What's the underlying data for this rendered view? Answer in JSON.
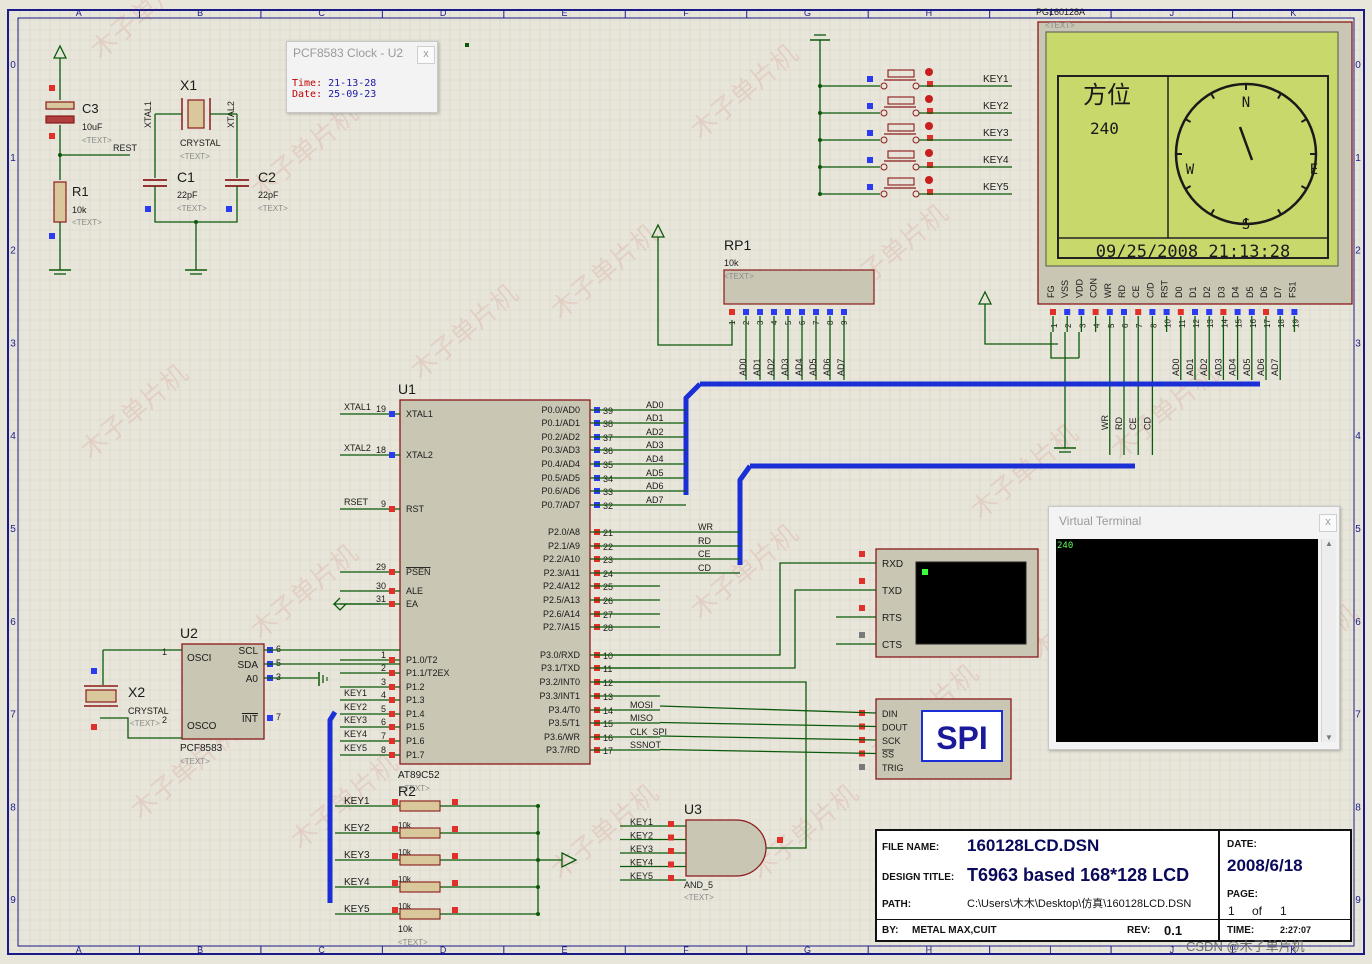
{
  "grid": {
    "cols": [
      "A",
      "B",
      "C",
      "D",
      "E",
      "F",
      "G",
      "H",
      "I",
      "J",
      "K"
    ],
    "rows": [
      "0",
      "1",
      "2",
      "3",
      "4",
      "5",
      "6",
      "7",
      "8",
      "9"
    ]
  },
  "clock_window": {
    "title": "PCF8583 Clock - U2",
    "close": "x",
    "time_label": "Time:",
    "time_value": "21-13-28",
    "date_label": "Date:",
    "date_value": "25-09-23"
  },
  "lcd": {
    "part": "PG160128A",
    "text_tag": "<TEXT>",
    "heading": "方位",
    "value": "240",
    "compass": {
      "north": "N",
      "south": "S",
      "east": "E",
      "west": "W"
    },
    "datetime": "09/25/2008 21:13:28",
    "pins": [
      "FG",
      "VSS",
      "VDD",
      "CON",
      "WR",
      "RD",
      "CE",
      "C/D",
      "RST",
      "D0",
      "D1",
      "D2",
      "D3",
      "D4",
      "D5",
      "D6",
      "D7",
      "FS1"
    ],
    "pin_numbers": [
      "1",
      "2",
      "3",
      "4",
      "5",
      "6",
      "7",
      "8",
      "10",
      "11",
      "12",
      "13",
      "14",
      "15",
      "16",
      "17",
      "18",
      "19"
    ],
    "bus_labels": [
      "AD0",
      "AD1",
      "AD2",
      "AD3",
      "AD4",
      "AD5",
      "AD6",
      "AD7"
    ],
    "ctrl_labels": [
      "WR",
      "RD",
      "CE",
      "CD"
    ]
  },
  "virtual_terminal": {
    "title": "Virtual Terminal",
    "close": "x",
    "output": "240"
  },
  "keys": [
    "KEY1",
    "KEY2",
    "KEY3",
    "KEY4",
    "KEY5"
  ],
  "components": {
    "c3": {
      "name": "C3",
      "value": "10uF",
      "text": "<TEXT>"
    },
    "rest_net": "REST",
    "r1": {
      "name": "R1",
      "value": "10k",
      "text": "<TEXT>"
    },
    "x1": {
      "name": "X1",
      "value": "CRYSTAL",
      "text": "<TEXT>",
      "left_net": "XTAL1",
      "right_net": "XTAL2"
    },
    "c1": {
      "name": "C1",
      "value": "22pF",
      "text": "<TEXT>"
    },
    "c2": {
      "name": "C2",
      "value": "22pF",
      "text": "<TEXT>"
    },
    "rp1": {
      "name": "RP1",
      "value": "10k",
      "text": "<TEXT>",
      "pins": [
        "1",
        "2",
        "3",
        "4",
        "5",
        "6",
        "7",
        "8",
        "9"
      ]
    },
    "u1": {
      "name": "U1",
      "part": "AT89C52",
      "text": "<TEXT>",
      "left_pins": [
        {
          "net": "XTAL1",
          "num": "19",
          "name": "XTAL1"
        },
        {
          "net": "XTAL2",
          "num": "18",
          "name": "XTAL2"
        },
        {
          "net": "RSET",
          "num": "9",
          "name": "RST"
        },
        {
          "net": "",
          "num": "29",
          "name": "PSEN"
        },
        {
          "net": "",
          "num": "30",
          "name": "ALE"
        },
        {
          "net": "",
          "num": "31",
          "name": "EA"
        },
        {
          "net": "",
          "num": "1",
          "name": "P1.0/T2"
        },
        {
          "net": "",
          "num": "2",
          "name": "P1.1/T2EX"
        },
        {
          "net": "",
          "num": "3",
          "name": "P1.2"
        },
        {
          "net": "KEY1",
          "num": "4",
          "name": "P1.3"
        },
        {
          "net": "KEY2",
          "num": "5",
          "name": "P1.4"
        },
        {
          "net": "KEY3",
          "num": "6",
          "name": "P1.5"
        },
        {
          "net": "KEY4",
          "num": "7",
          "name": "P1.6"
        },
        {
          "net": "KEY5",
          "num": "8",
          "name": "P1.7"
        }
      ],
      "right_pins": [
        {
          "name": "P0.0/AD0",
          "num": "39",
          "net": "AD0"
        },
        {
          "name": "P0.1/AD1",
          "num": "38",
          "net": "AD1"
        },
        {
          "name": "P0.2/AD2",
          "num": "37",
          "net": "AD2"
        },
        {
          "name": "P0.3/AD3",
          "num": "36",
          "net": "AD3"
        },
        {
          "name": "P0.4/AD4",
          "num": "35",
          "net": "AD4"
        },
        {
          "name": "P0.5/AD5",
          "num": "34",
          "net": "AD5"
        },
        {
          "name": "P0.6/AD6",
          "num": "33",
          "net": "AD6"
        },
        {
          "name": "P0.7/AD7",
          "num": "32",
          "net": "AD7"
        },
        {
          "name": "P2.0/A8",
          "num": "21",
          "net": "WR"
        },
        {
          "name": "P2.1/A9",
          "num": "22",
          "net": "RD"
        },
        {
          "name": "P2.2/A10",
          "num": "23",
          "net": "CE"
        },
        {
          "name": "P2.3/A11",
          "num": "24",
          "net": "CD"
        },
        {
          "name": "P2.4/A12",
          "num": "25",
          "net": ""
        },
        {
          "name": "P2.5/A13",
          "num": "26",
          "net": ""
        },
        {
          "name": "P2.6/A14",
          "num": "27",
          "net": ""
        },
        {
          "name": "P2.7/A15",
          "num": "28",
          "net": ""
        },
        {
          "name": "P3.0/RXD",
          "num": "10",
          "net": ""
        },
        {
          "name": "P3.1/TXD",
          "num": "11",
          "net": ""
        },
        {
          "name": "P3.2/INT0",
          "num": "12",
          "net": ""
        },
        {
          "name": "P3.3/INT1",
          "num": "13",
          "net": ""
        },
        {
          "name": "P3.4/T0",
          "num": "14",
          "net": "MOSI"
        },
        {
          "name": "P3.5/T1",
          "num": "15",
          "net": "MISO"
        },
        {
          "name": "P3.6/WR",
          "num": "16",
          "net": "CLK_SPI"
        },
        {
          "name": "P3.7/RD",
          "num": "17",
          "net": "SSNOT"
        }
      ]
    },
    "u2": {
      "name": "U2",
      "part": "PCF8583",
      "text": "<TEXT>",
      "pins_left": [
        {
          "num": "1",
          "name": "OSCI"
        },
        {
          "num": "2",
          "name": "OSCO"
        }
      ],
      "pins_right": [
        {
          "num": "6",
          "name": "SCL"
        },
        {
          "num": "5",
          "name": "SDA"
        },
        {
          "num": "3",
          "name": "A0"
        },
        {
          "num": "7",
          "name": "INT"
        }
      ]
    },
    "x2": {
      "name": "X2",
      "value": "CRYSTAL",
      "text": "<TEXT>"
    },
    "u3": {
      "name": "U3",
      "part": "AND_5",
      "text": "<TEXT>"
    },
    "r2": {
      "name": "R2",
      "value": "10k",
      "text": "<TEXT>",
      "sub": [
        "10k",
        "10k",
        "10k",
        "10k"
      ]
    },
    "uart": {
      "pins": [
        "RXD",
        "TXD",
        "RTS",
        "CTS"
      ]
    },
    "spi": {
      "pins": [
        "DIN",
        "DOUT",
        "SCK",
        "SS",
        "TRIG"
      ],
      "label": "SPI"
    }
  },
  "title_block": {
    "file_name_label": "FILE NAME:",
    "file_name": "160128LCD.DSN",
    "design_title_label": "DESIGN TITLE:",
    "design_title": "T6963 based 168*128 LCD",
    "path_label": "PATH:",
    "path": "C:\\Users\\木木\\Desktop\\仿真\\160128LCD.DSN",
    "by_label": "BY:",
    "by": "METAL MAX,CUIT",
    "rev_label": "REV:",
    "rev": "0.1",
    "date_label": "DATE:",
    "date": "2008/6/18",
    "page_label": "PAGE:",
    "page": "1",
    "of_label": "of",
    "page_total": "1",
    "time_label": "TIME:",
    "time": "2:27:07"
  },
  "watermark": "木子单片机",
  "footer_credit": "CSDN @木子单片机",
  "colors": {
    "wire": "#0b5a0b",
    "bus": "#1a2fd6",
    "part_body": "#c9c6b4",
    "part_outline": "#8b1a1a",
    "lcd_bg": "#c9d86b",
    "pin_red": "#e0302a",
    "pin_blue": "#2a3bf0",
    "grid_border": "#1a1a8a"
  }
}
